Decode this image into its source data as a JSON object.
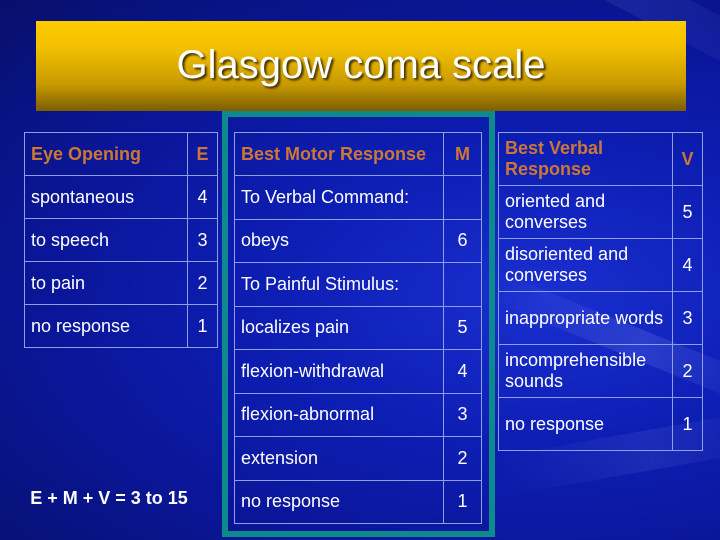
{
  "slide": {
    "title": "Glasgow coma scale",
    "colors": {
      "background": "#0d1eb4",
      "title_bar": "#f2c000",
      "header_text": "#cc7733",
      "teal_frame": "#0f8a8c",
      "table_border": "#8f9ee6"
    }
  },
  "eye": {
    "header": {
      "label": "Eye Opening",
      "code": "E"
    },
    "rows": [
      {
        "label": "spontaneous",
        "score": "4"
      },
      {
        "label": "to speech",
        "score": "3"
      },
      {
        "label": "to pain",
        "score": "2"
      },
      {
        "label": "no response",
        "score": "1"
      }
    ]
  },
  "motor": {
    "header": {
      "label": "Best Motor Response",
      "code": "M"
    },
    "rows": [
      {
        "label": "To Verbal Command:",
        "score": ""
      },
      {
        "label": "obeys",
        "score": "6"
      },
      {
        "label": "To Painful Stimulus:",
        "score": ""
      },
      {
        "label": "localizes pain",
        "score": "5"
      },
      {
        "label": "flexion-withdrawal",
        "score": "4"
      },
      {
        "label": "flexion-abnormal",
        "score": "3"
      },
      {
        "label": "extension",
        "score": "2"
      },
      {
        "label": "no response",
        "score": "1"
      }
    ]
  },
  "verbal": {
    "header": {
      "label": "Best Verbal Response",
      "code": "V"
    },
    "rows": [
      {
        "label": "oriented and converses",
        "score": "5"
      },
      {
        "label": "disoriented and converses",
        "score": "4"
      },
      {
        "label": "inappropriate words",
        "score": "3"
      },
      {
        "label": "incomprehensible sounds",
        "score": "2"
      },
      {
        "label": "no response",
        "score": "1"
      }
    ]
  },
  "formula": "E + M + V = 3 to 15"
}
